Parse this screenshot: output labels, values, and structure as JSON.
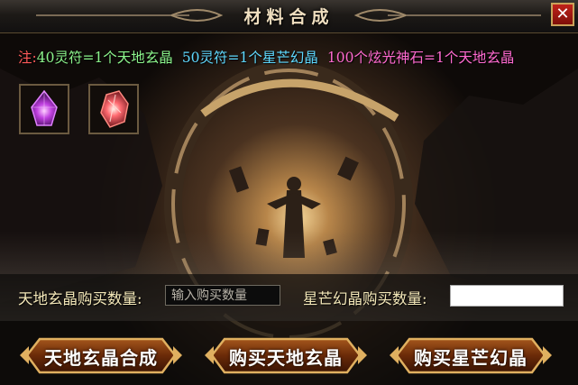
{
  "window": {
    "title": "材料合成",
    "close_glyph": "✕"
  },
  "note": {
    "prefix": "注:",
    "rule1": "40灵符=1个天地玄晶",
    "rule2": "50灵符=1个星芒幻晶",
    "rule3": "100个炫光神石=1个天地玄晶",
    "colors": {
      "prefix": "#ff5a5a",
      "rule1": "#8cf58c",
      "rule2": "#5fd9ff",
      "rule3": "#ff6ad0"
    }
  },
  "materials": [
    {
      "icon": "purple-crystal-icon"
    },
    {
      "icon": "red-crystal-icon"
    }
  ],
  "purchase": {
    "tiandi_label": "天地玄晶购买数量:",
    "tiandi_placeholder": "输入购买数量",
    "xingmang_label": "星芒幻晶购买数量:",
    "xingmang_value": ""
  },
  "buttons": {
    "synthesize": "天地玄晶合成",
    "buy_tiandi": "购买天地玄晶",
    "buy_xingmang": "购买星芒幻晶"
  }
}
